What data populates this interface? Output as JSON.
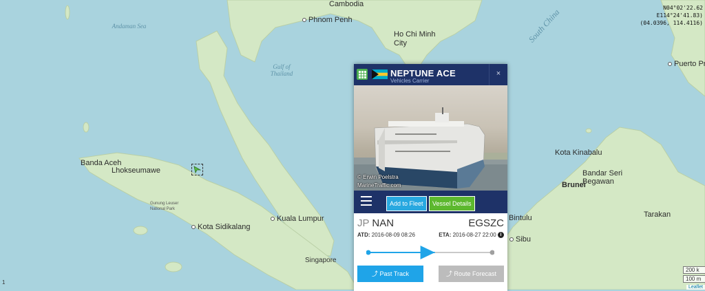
{
  "map": {
    "cities": [
      {
        "label": "Cambodia"
      },
      {
        "label": "Phnom Penh"
      },
      {
        "label": "Ho Chi Minh City"
      },
      {
        "label": "Banda Aceh"
      },
      {
        "label": "Lhokseumawe"
      },
      {
        "label": "Kota Sidikalang"
      },
      {
        "label": "Kuala Lumpur"
      },
      {
        "label": "Singapore"
      },
      {
        "label": "Kota Kinabalu"
      },
      {
        "label": "Bandar Seri Begawan"
      },
      {
        "label": "Brunei"
      },
      {
        "label": "Tarakan"
      },
      {
        "label": "Bintulu"
      },
      {
        "label": "Sibu"
      },
      {
        "label": "Puerto Pri"
      }
    ],
    "water_labels": [
      "Andaman Sea",
      "Gulf of Thailand",
      "South China"
    ],
    "park_label": "Gunung Leuser National Park",
    "cursor_coords": [
      "N04°02'22.62",
      "E114°24'41.83)",
      "(04.0396, 114.4116)"
    ],
    "scale": [
      "200 k",
      "100 m"
    ],
    "attribution": "Leaflet",
    "small_mark": "1"
  },
  "popup": {
    "vessel_name": "NEPTUNE ACE",
    "vessel_type": "Vehicles Carrier",
    "close_label": "×",
    "photo_credit_1": "© Erwin Poelstra",
    "photo_credit_2": "MarineTraffic.com",
    "add_fleet_label": "Add to Fleet",
    "details_label": "Vessel Details",
    "origin_cc": "JP",
    "origin_port": "NAN",
    "destination": "EGSZC",
    "atd_label": "ATD:",
    "atd_value": "2016-08-09 08:26",
    "eta_label": "ETA:",
    "eta_value": "2016-08-27 22:00",
    "info_icon_glyph": "i",
    "past_track_label": "Past Track",
    "route_forecast_label": "Route Forecast",
    "voyage_progress": 0.47
  },
  "colors": {
    "sea": "#a9d3de",
    "land": "#d4e8c5",
    "header": "#1e3268",
    "accent_blue": "#1fa4e8",
    "accent_green": "#5cb82e"
  }
}
